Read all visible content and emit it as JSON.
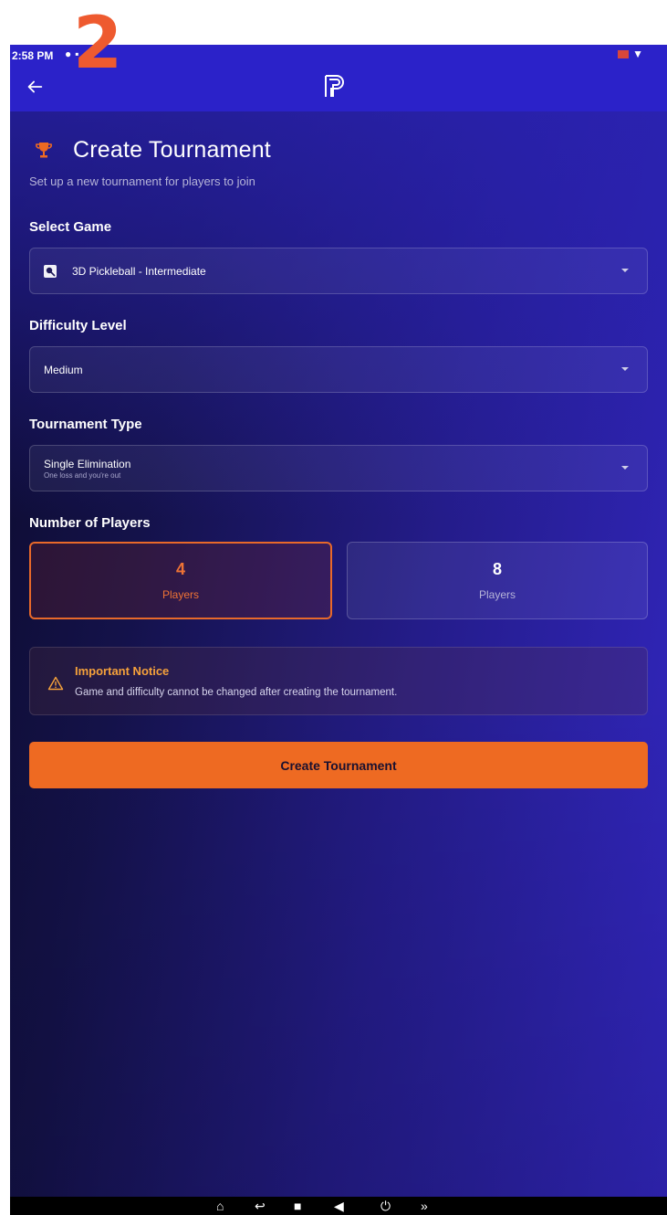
{
  "step_badge": "2",
  "status_bar": {
    "time": "2:58 PM",
    "left_icons": [
      "check-circle-icon",
      "notification-icon",
      "shield-icon"
    ],
    "right_icons": [
      "sim-icon",
      "wifi-icon"
    ]
  },
  "appbar": {
    "back_icon": "arrow-left-icon",
    "logo_icon": "p-logo-icon"
  },
  "page": {
    "title": "Create Tournament",
    "subtitle": "Set up a new tournament for players to join"
  },
  "form": {
    "game": {
      "label": "Select Game",
      "value": "3D Pickleball - Intermediate"
    },
    "difficulty": {
      "label": "Difficulty Level",
      "value": "Medium"
    },
    "type": {
      "label": "Tournament Type",
      "value": "Single Elimination",
      "description": "One loss and you're out"
    },
    "players": {
      "label": "Number of Players",
      "options": [
        {
          "count": "4",
          "label": "Players",
          "selected": true
        },
        {
          "count": "8",
          "label": "Players",
          "selected": false
        }
      ]
    }
  },
  "notice": {
    "title": "Important Notice",
    "text": "Game and difficulty cannot be changed after creating the tournament."
  },
  "submit_label": "Create Tournament",
  "colors": {
    "accent": "#ee6a22",
    "appbar": "#2b22c9",
    "notice_title": "#f5a13b",
    "badge": "#ee5a2f"
  },
  "navbar_icons": [
    "home-icon",
    "back-icon",
    "recents-icon",
    "volume-icon",
    "power-icon",
    "chevrons-down-icon"
  ]
}
